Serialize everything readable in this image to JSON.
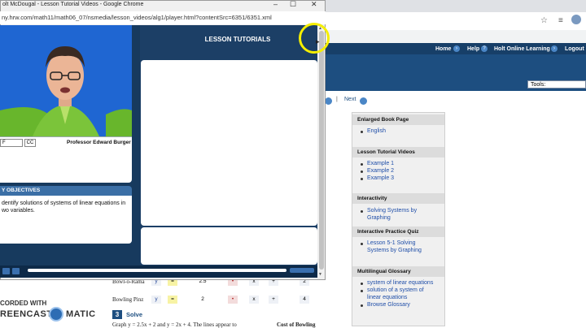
{
  "popup": {
    "title": "olt McDougal - Lesson Tutorial Videos - Google Chrome",
    "url": "ny.hrw.com/math11/math06_07/nsmedia/lesson_videos/alg1/player.html?contentSrc=6351/6351.xml",
    "window_buttons": [
      "–",
      "☐",
      "✕"
    ],
    "lesson_tutorials_title": "LESSON TUTORIALS",
    "caption_field": "F",
    "cc_label": "CC",
    "professor": "Professor Edward Burger",
    "objectives_title": "Y OBJECTIVES",
    "objectives_text": "dentify solutions of systems of linear equations in wo variables."
  },
  "site": {
    "nav": [
      "Home",
      "Help",
      "Holt Online Learning",
      "Logout"
    ],
    "tools_label": "Tools:",
    "next_label": "Next",
    "separator": "|"
  },
  "right_panel": {
    "sections": [
      {
        "head": "Enlarged Book Page",
        "links": [
          "English"
        ]
      },
      {
        "head": "Lesson Tutorial Videos",
        "links": [
          "Example 1",
          "Example 2",
          "Example 3"
        ]
      },
      {
        "head": "Interactivity",
        "links": [
          "Solving Systems by",
          "Graphing"
        ]
      },
      {
        "head": "Interactive Practice Quiz",
        "links": [
          "Lesson 5-1 Solving",
          "Systems by Graphing"
        ]
      },
      {
        "head": "Multilingual Glossary",
        "links": [
          "system of linear equations",
          "solution of a system of",
          "linear equations",
          "Browse Glossary"
        ]
      }
    ]
  },
  "lesson": {
    "rows": [
      {
        "label": "Bowl-o-Rama",
        "cells": [
          "y",
          "=",
          "2.5",
          "•",
          "x",
          "+",
          "2"
        ]
      },
      {
        "label": "Bowling Pinz",
        "cells": [
          "y",
          "=",
          "2",
          "•",
          "x",
          "+",
          "4"
        ]
      }
    ],
    "step_number": "3",
    "step_label": "Solve",
    "graph_text": "Graph y = 2.5x + 2 and y = 2x + 4. The lines appear to",
    "cost_label": "Cost of Bowling"
  },
  "watermark": {
    "line1": "CORDED WITH",
    "line2": "REENCAST",
    "line3": "MATIC"
  },
  "colors": {
    "accent": "#1d4e80",
    "highlight": "#f5ee00",
    "player_bg": "#173a5e"
  }
}
